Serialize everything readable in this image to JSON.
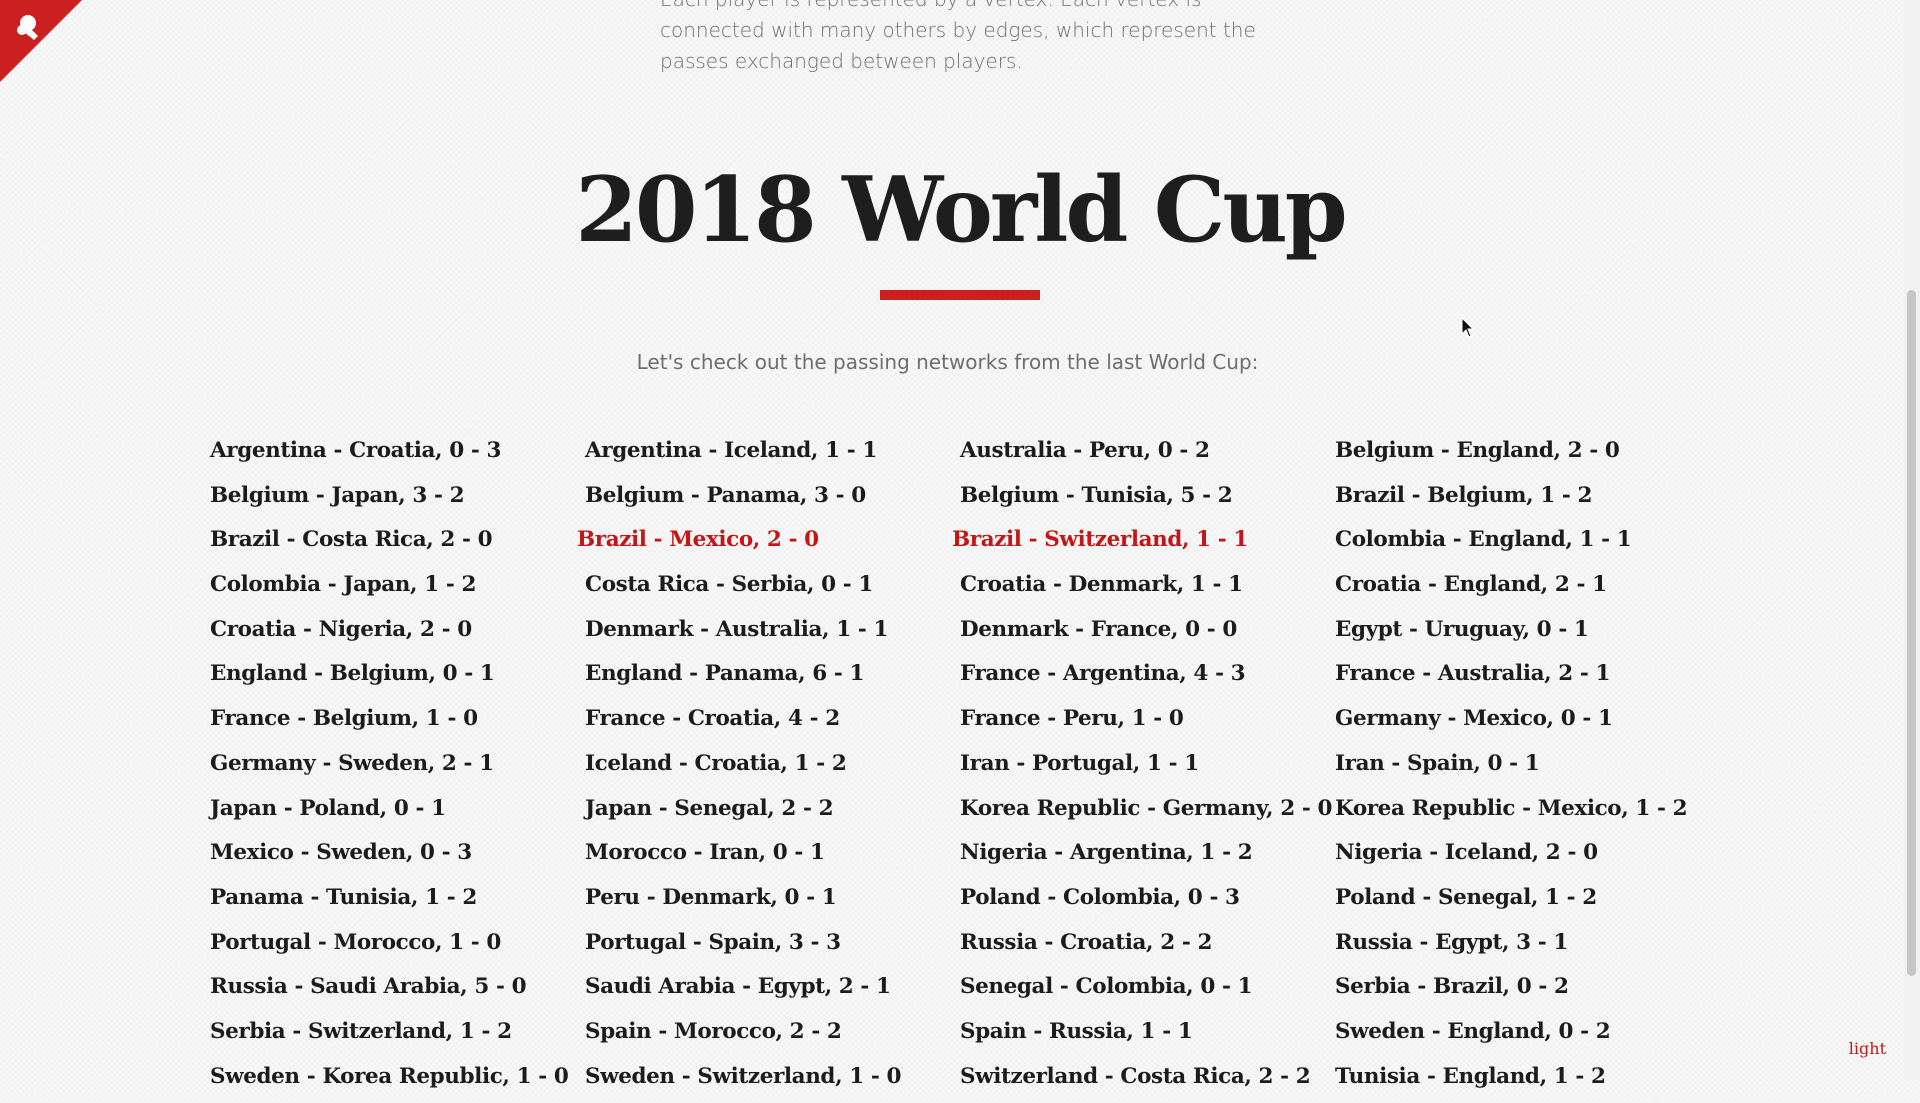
{
  "intro": {
    "text": "Each player is represented by a vertex. Each vertex is connected with many others by edges, which represent the passes exchanged between players."
  },
  "title": "2018 World Cup",
  "subtitle": "Let's check out the passing networks from the last World Cup:",
  "matches": [
    "Argentina - Croatia, 0 - 3",
    "Argentina - Iceland, 1 - 1",
    "Australia - Peru, 0 - 2",
    "Belgium - England, 2 - 0",
    "Belgium - Japan, 3 - 2",
    "Belgium - Panama, 3 - 0",
    "Belgium - Tunisia, 5 - 2",
    "Brazil - Belgium, 1 - 2",
    "Brazil - Costa Rica, 2 - 0",
    "Brazil - Mexico, 2 - 0",
    "Brazil - Switzerland, 1 - 1",
    "Colombia - England, 1 - 1",
    "Colombia - Japan, 1 - 2",
    "Costa Rica - Serbia, 0 - 1",
    "Croatia - Denmark, 1 - 1",
    "Croatia - England, 2 - 1",
    "Croatia - Nigeria, 2 - 0",
    "Denmark - Australia, 1 - 1",
    "Denmark - France, 0 - 0",
    "Egypt - Uruguay, 0 - 1",
    "England - Belgium, 0 - 1",
    "England - Panama, 6 - 1",
    "France - Argentina, 4 - 3",
    "France - Australia, 2 - 1",
    "France - Belgium, 1 - 0",
    "France - Croatia, 4 - 2",
    "France - Peru, 1 - 0",
    "Germany - Mexico, 0 - 1",
    "Germany - Sweden, 2 - 1",
    "Iceland - Croatia, 1 - 2",
    "Iran - Portugal, 1 - 1",
    "Iran - Spain, 0 - 1",
    "Japan - Poland, 0 - 1",
    "Japan - Senegal, 2 - 2",
    "Korea Republic - Germany, 2 - 0",
    "Korea Republic - Mexico, 1 - 2",
    "Mexico - Sweden, 0 - 3",
    "Morocco - Iran, 0 - 1",
    "Nigeria - Argentina, 1 - 2",
    "Nigeria - Iceland, 2 - 0",
    "Panama - Tunisia, 1 - 2",
    "Peru - Denmark, 0 - 1",
    "Poland - Colombia, 0 - 3",
    "Poland - Senegal, 1 - 2",
    "Portugal - Morocco, 1 - 0",
    "Portugal - Spain, 3 - 3",
    "Russia - Croatia, 2 - 2",
    "Russia - Egypt, 3 - 1",
    "Russia - Saudi Arabia, 5 - 0",
    "Saudi Arabia - Egypt, 2 - 1",
    "Senegal - Colombia, 0 - 1",
    "Serbia - Brazil, 0 - 2",
    "Serbia - Switzerland, 1 - 2",
    "Spain - Morocco, 2 - 2",
    "Spain - Russia, 1 - 1",
    "Sweden - England, 0 - 2",
    "Sweden - Korea Republic, 1 - 0",
    "Sweden - Switzerland, 1 - 0",
    "Switzerland - Costa Rica, 2 - 2",
    "Tunisia - England, 1 - 2"
  ],
  "highlighted": [
    "Brazil - Mexico, 2 - 0",
    "Brazil - Switzerland, 1 - 1"
  ],
  "theme_toggle": "light",
  "colors": {
    "accent": "#cc1f1f",
    "text": "#1c1c1c",
    "muted": "#6e6e6e",
    "background": "#f7f7f7"
  },
  "icons": {
    "logo": "network-logo-icon",
    "cursor": "mouse-pointer-icon"
  }
}
